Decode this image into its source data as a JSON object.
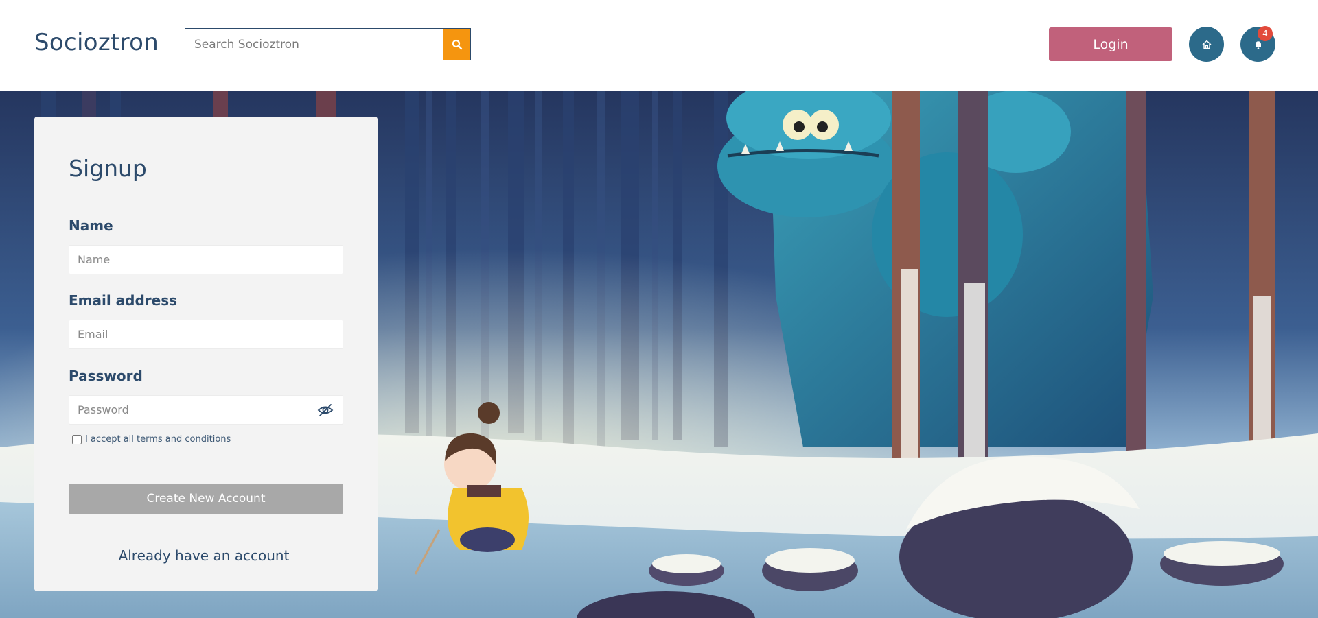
{
  "header": {
    "brand": "Socioztron",
    "search_placeholder": "Search Socioztron",
    "login_label": "Login",
    "notification_count": "4"
  },
  "signup": {
    "title": "Signup",
    "name_label": "Name",
    "name_placeholder": "Name",
    "email_label": "Email address",
    "email_placeholder": "Email",
    "password_label": "Password",
    "password_placeholder": "Password",
    "terms_label": "I accept all terms and conditions",
    "terms_checked": false,
    "create_label": "Create New Account",
    "already_label": "Already have an account"
  },
  "icons": {
    "search": "search-icon",
    "home": "home-icon",
    "bell": "bell-icon",
    "eye": "eye-slash-icon"
  },
  "colors": {
    "brand": "#2c4a6b",
    "search_button": "#f5950f",
    "login_button": "#c1617b",
    "icon_button": "#2c6a8a",
    "badge": "#e24a3b",
    "create_button_disabled": "#a8a8a8"
  }
}
